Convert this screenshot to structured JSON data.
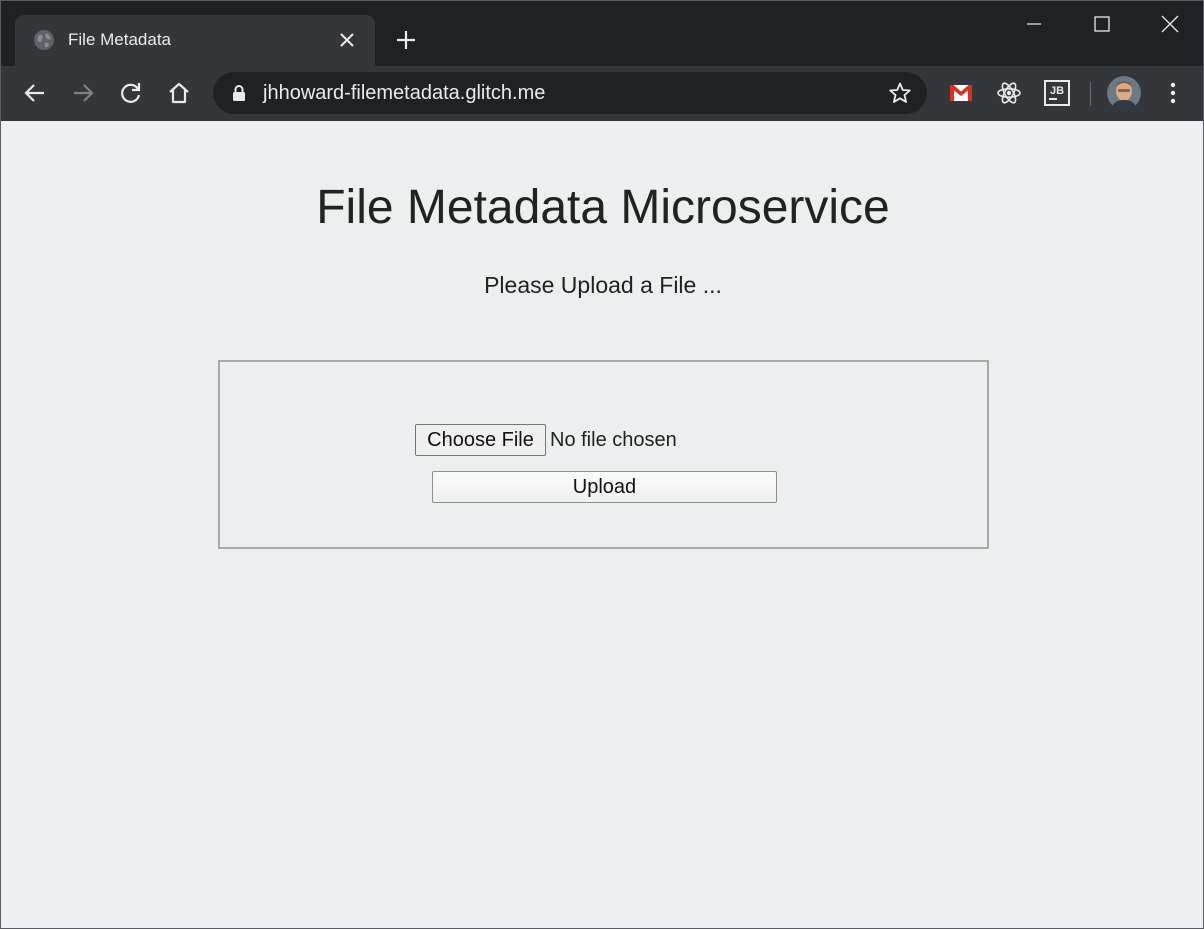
{
  "browser": {
    "tab": {
      "title": "File Metadata",
      "favicon": "globe-icon",
      "close_icon": "close-icon"
    },
    "new_tab_icon": "plus-icon",
    "window_controls": [
      "minimize-icon",
      "maximize-icon",
      "close-icon"
    ],
    "toolbar": {
      "back_icon": "back-arrow-icon",
      "forward_icon": "forward-arrow-icon",
      "reload_icon": "reload-icon",
      "home_icon": "home-icon",
      "lock_icon": "lock-icon",
      "url": "jhhoward-filemetadata.glitch.me",
      "bookmark_icon": "star-icon",
      "extensions": [
        "gmail-icon",
        "react-devtools-icon",
        "jetbrains-icon"
      ],
      "menu_icon": "kebab-menu-icon"
    },
    "colors": {
      "frame": "#1f2124",
      "toolbar": "#35363a",
      "omnibox": "#202124",
      "page_bg": "#ebeff0",
      "gmail_red": "#d93025"
    }
  },
  "page": {
    "title": "File Metadata Microservice",
    "subtitle": "Please Upload a File ...",
    "form": {
      "choose_file_label": "Choose File",
      "file_status": "No file chosen",
      "upload_label": "Upload"
    }
  }
}
